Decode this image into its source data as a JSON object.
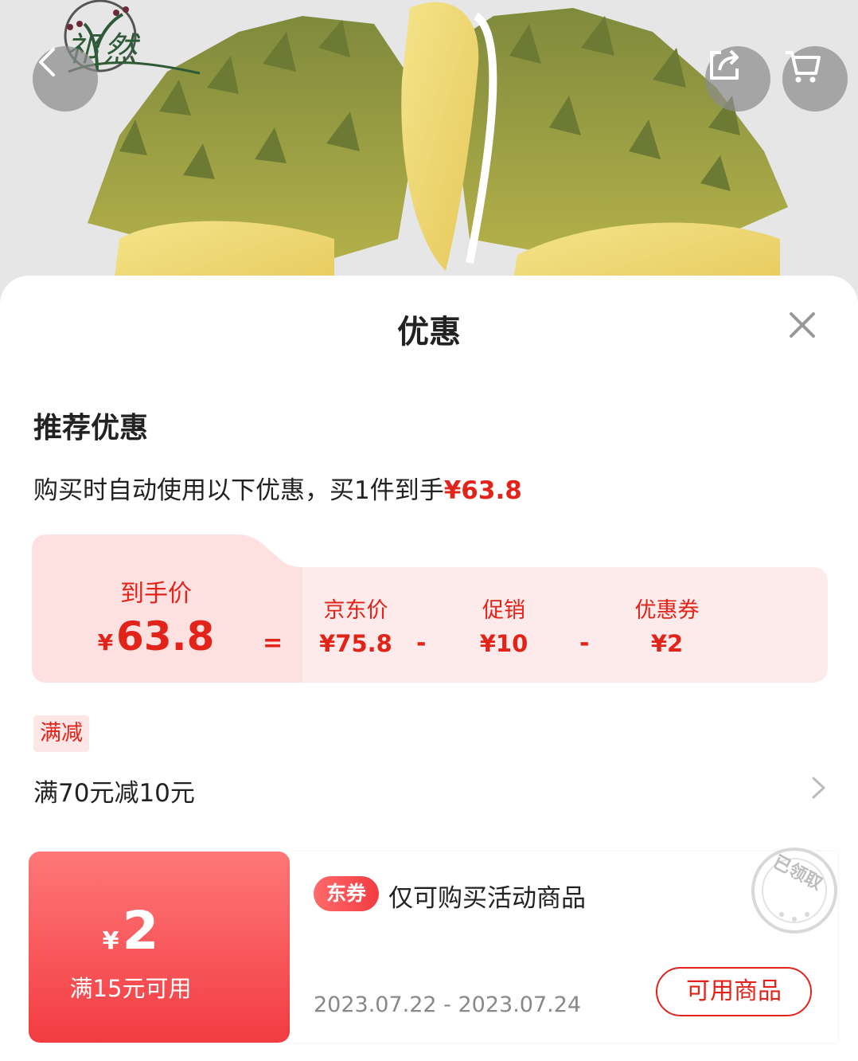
{
  "hero": {
    "brand_name": "祁然",
    "back_icon": "chevron-left-icon",
    "share_icon": "share-icon",
    "cart_icon": "cart-icon"
  },
  "sheet": {
    "title": "优惠",
    "close_icon": "close-icon"
  },
  "recommended": {
    "section_title": "推荐优惠",
    "description": "购买时自动使用以下优惠，买1件到手",
    "description_price": "¥63.8"
  },
  "breakdown": {
    "final_label": "到手价",
    "final_currency": "¥",
    "final_value": "63.8",
    "equals": "=",
    "minus": "-",
    "items": [
      {
        "label": "京东价",
        "value": "¥75.8"
      },
      {
        "label": "促销",
        "value": "¥10"
      },
      {
        "label": "优惠券",
        "value": "¥2"
      }
    ]
  },
  "promotion": {
    "tag": "满减",
    "text": "满70元减10元"
  },
  "coupon": {
    "currency": "¥",
    "amount": "2",
    "condition": "满15元可用",
    "badge": "东券",
    "description": "仅可购买活动商品",
    "date_range": "2023.07.22 - 2023.07.24",
    "button_label": "可用商品",
    "stamp_text": "已领取"
  },
  "colors": {
    "accent": "#e2231a",
    "panel_bg": "#fdeaea",
    "coupon_gradient_top": "#ff7878",
    "coupon_gradient_bottom": "#f23c42"
  }
}
